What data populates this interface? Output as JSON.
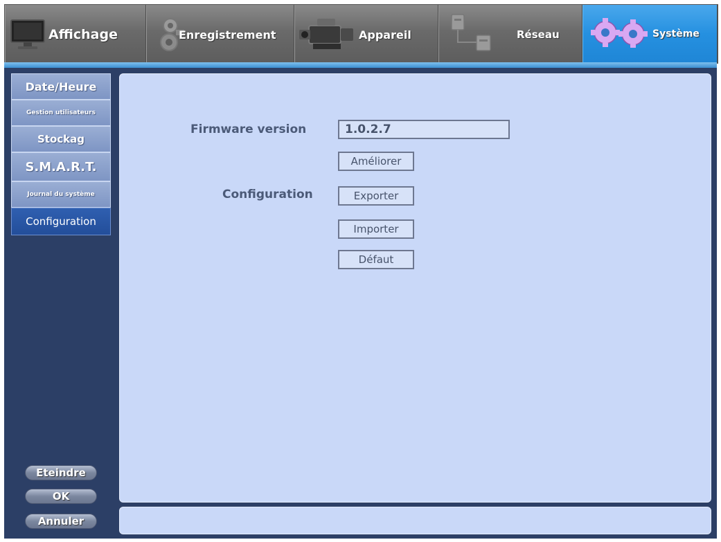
{
  "tabs": [
    {
      "label": "Affichage",
      "icon": "monitor-icon",
      "active": false
    },
    {
      "label": "Enregistrement",
      "icon": "camera-icon",
      "active": false
    },
    {
      "label": "Appareil",
      "icon": "camcorder-icon",
      "active": false
    },
    {
      "label": "Réseau",
      "icon": "network-icon",
      "active": false
    },
    {
      "label": "Système",
      "icon": "gears-icon",
      "active": true
    }
  ],
  "sidebar": {
    "items": [
      {
        "label": "Date/Heure"
      },
      {
        "label": "Gestion utilisateurs"
      },
      {
        "label": "Stockag"
      },
      {
        "label": "S.M.A.R.T."
      },
      {
        "label": "Journal du système"
      },
      {
        "label": "Configuration",
        "active": true
      }
    ],
    "buttons": {
      "shutdown": "Eteindre",
      "ok": "OK",
      "cancel": "Annuler"
    }
  },
  "main": {
    "firmware_label": "Firmware version",
    "firmware_value": "1.0.2.7",
    "upgrade_button": "Améliorer",
    "configuration_label": "Configuration",
    "export_button": "Exporter",
    "import_button": "Importer",
    "default_button": "Défaut"
  },
  "colors": {
    "active_tab": "#2590e0",
    "panel_bg": "#c9d8f8",
    "frame_bg": "#2c3f66"
  }
}
